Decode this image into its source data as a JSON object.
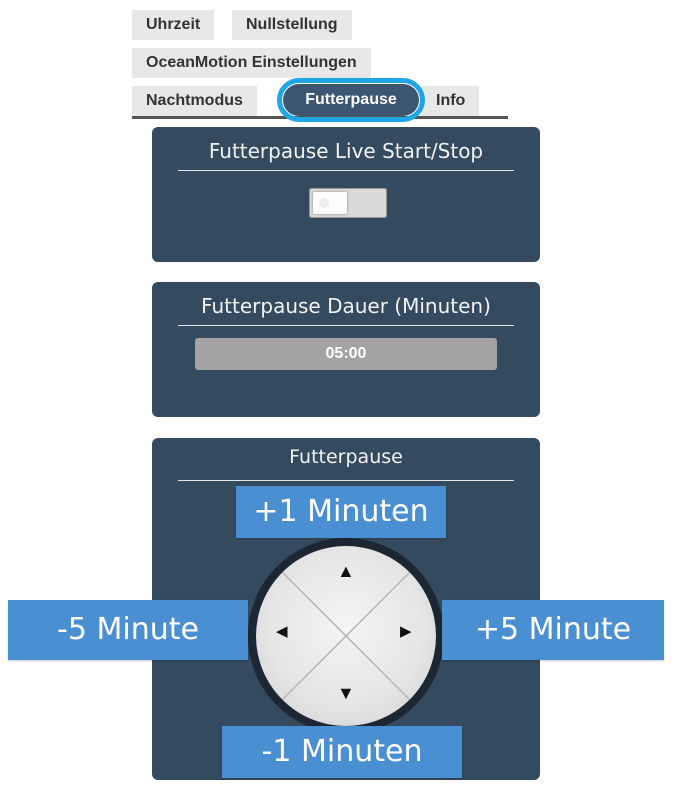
{
  "tabs": {
    "row1": [
      "Uhrzeit",
      "Nullstellung"
    ],
    "row2": [
      "OceanMotion Einstellungen"
    ],
    "row3": [
      "Nachtmodus",
      "Futterpause",
      "Info"
    ],
    "active": "Futterpause"
  },
  "live_panel": {
    "title": "Futterpause Live Start/Stop",
    "toggle_state": "off"
  },
  "duration_panel": {
    "title": "Futterpause Dauer (Minuten)",
    "value": "05:00"
  },
  "control_panel": {
    "title": "Futterpause",
    "arrows": {
      "up": "▲",
      "down": "▼",
      "left": "◀",
      "right": "▶"
    }
  },
  "callouts": {
    "up": "+1 Minuten",
    "down": "-1 Minuten",
    "left": "-5 Minute",
    "right": "+5 Minute"
  },
  "colors": {
    "panel": "#344a5f",
    "active_tab": "#3b5572",
    "highlight": "#20a6e6",
    "callout": "#4a8fd1"
  }
}
